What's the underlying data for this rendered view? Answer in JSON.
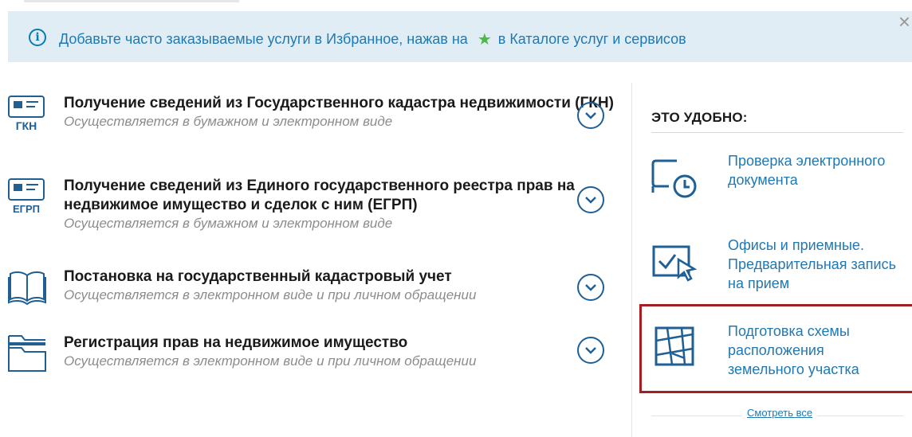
{
  "banner": {
    "text_before": "Добавьте часто заказываемые услуги в Избранное, нажав на",
    "text_after": "в Каталоге услуг и сервисов",
    "info_symbol": "i",
    "star_symbol": "★",
    "close_symbol": "×"
  },
  "services": [
    {
      "icon": "gkn-document-icon",
      "icon_label": "ГКН",
      "title": "Получение сведений из Государственного кадастра недвижимости (ГКН)",
      "subtitle": "Осуществляется в бумажном и электронном виде"
    },
    {
      "icon": "egrp-document-icon",
      "icon_label": "ЕГРП",
      "title": "Получение сведений из Единого государственного реестра прав на недвижимое имущество и сделок с ним (ЕГРП)",
      "subtitle": "Осуществляется в бумажном и электронном виде"
    },
    {
      "icon": "open-book-icon",
      "title": "Постановка на государственный кадастровый учет",
      "subtitle": "Осуществляется в электронном виде и при личном обращении"
    },
    {
      "icon": "folder-icon",
      "title": "Регистрация прав на недвижимое имущество",
      "subtitle": "Осуществляется в электронном виде и при личном обращении"
    }
  ],
  "sidebar": {
    "heading": "ЭТО УДОБНО:",
    "items": [
      {
        "icon": "monitor-clock-icon",
        "label": "Проверка электронного документа"
      },
      {
        "icon": "window-cursor-icon",
        "label": "Офисы и приемные. Предварительная запись на прием"
      },
      {
        "icon": "land-plot-map-icon",
        "label": "Подготовка схемы расположения земельного участка"
      }
    ],
    "more_link": "Смотреть все"
  },
  "colors": {
    "accent": "#1f78b4",
    "icon_blue": "#1f5f94",
    "banner_bg": "#e0edf4",
    "star": "#4cb847",
    "highlight": "#a61e22",
    "subtitle": "#8c8c8c"
  }
}
